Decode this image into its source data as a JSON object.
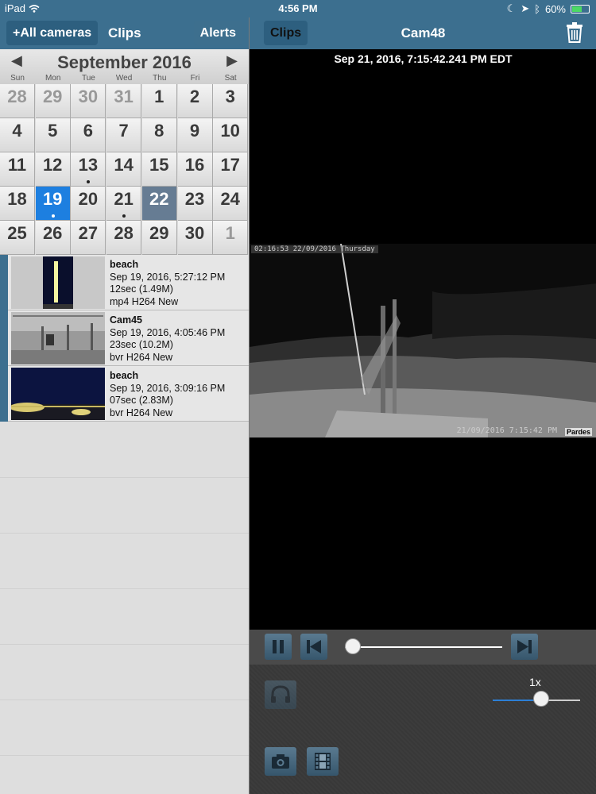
{
  "status_bar": {
    "device": "iPad",
    "time": "4:56 PM",
    "battery": "60%",
    "battery_level": 0.6
  },
  "left_nav": {
    "all_cameras": "+All cameras",
    "title": "Clips",
    "alerts": "Alerts"
  },
  "calendar": {
    "month": "September 2016",
    "weekdays": [
      "Sun",
      "Mon",
      "Tue",
      "Wed",
      "Thu",
      "Fri",
      "Sat"
    ],
    "weeks": [
      [
        {
          "d": "28",
          "o": true
        },
        {
          "d": "29",
          "o": true
        },
        {
          "d": "30",
          "o": true
        },
        {
          "d": "31",
          "o": true
        },
        {
          "d": "1"
        },
        {
          "d": "2"
        },
        {
          "d": "3"
        }
      ],
      [
        {
          "d": "4"
        },
        {
          "d": "5"
        },
        {
          "d": "6"
        },
        {
          "d": "7"
        },
        {
          "d": "8"
        },
        {
          "d": "9"
        },
        {
          "d": "10"
        }
      ],
      [
        {
          "d": "11"
        },
        {
          "d": "12"
        },
        {
          "d": "13",
          "dot": true
        },
        {
          "d": "14"
        },
        {
          "d": "15"
        },
        {
          "d": "16"
        },
        {
          "d": "17"
        }
      ],
      [
        {
          "d": "18"
        },
        {
          "d": "19",
          "sel": true,
          "dot": true
        },
        {
          "d": "20"
        },
        {
          "d": "21",
          "dot": true
        },
        {
          "d": "22",
          "today": true
        },
        {
          "d": "23"
        },
        {
          "d": "24"
        }
      ],
      [
        {
          "d": "25"
        },
        {
          "d": "26"
        },
        {
          "d": "27"
        },
        {
          "d": "28"
        },
        {
          "d": "29"
        },
        {
          "d": "30"
        },
        {
          "d": "1",
          "o": true
        }
      ]
    ]
  },
  "clips": [
    {
      "camera": "beach",
      "datetime": "Sep 19, 2016, 5:27:12 PM",
      "duration": "12sec (1.49M)",
      "format": "mp4 H264 New",
      "thumb": "beach-night-vertical"
    },
    {
      "camera": "Cam45",
      "datetime": "Sep 19, 2016, 4:05:46 PM",
      "duration": "23sec (10.2M)",
      "format": "bvr H264 New",
      "thumb": "porch"
    },
    {
      "camera": "beach",
      "datetime": "Sep 19, 2016, 3:09:16 PM",
      "duration": "07sec (2.83M)",
      "format": "bvr H264 New",
      "thumb": "beach-night"
    }
  ],
  "right_nav": {
    "clips": "Clips",
    "title": "Cam48"
  },
  "player": {
    "timestamp": "Sep 21, 2016, 7:15:42.241 PM EDT",
    "overlay_top": "02:16:53 22/09/2016  Thursday",
    "overlay_bottom": "21/09/2016 7:15:42 PM",
    "overlay_name": "Pardes",
    "progress": 0.05,
    "speed": "1x",
    "speed_level": 0.55
  },
  "colors": {
    "nav": "#3c6f8f",
    "selected_day": "#1d7fe0",
    "today": "#667c93"
  }
}
